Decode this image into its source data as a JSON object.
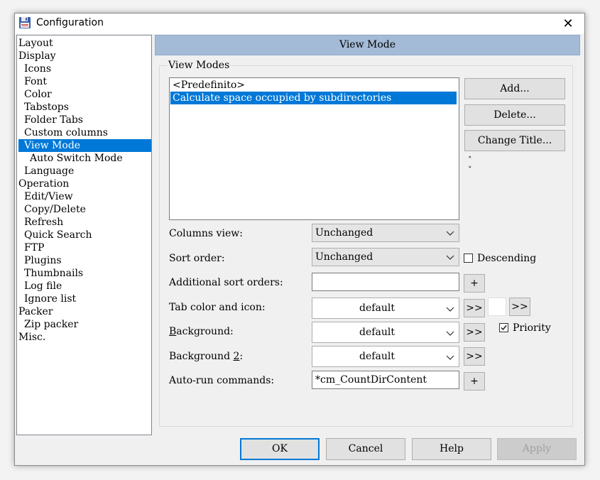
{
  "window": {
    "title": "Configuration",
    "close_glyph": "✕"
  },
  "tree": {
    "items": [
      {
        "label": "Layout"
      },
      {
        "label": "Display"
      },
      {
        "label": "Icons"
      },
      {
        "label": "Font"
      },
      {
        "label": "Color"
      },
      {
        "label": "Tabstops"
      },
      {
        "label": "Folder Tabs"
      },
      {
        "label": "Custom columns"
      },
      {
        "label": "View Mode",
        "selected": true
      },
      {
        "label": "Auto Switch Mode"
      },
      {
        "label": "Language"
      },
      {
        "label": "Operation"
      },
      {
        "label": "Edit/View"
      },
      {
        "label": "Copy/Delete"
      },
      {
        "label": "Refresh"
      },
      {
        "label": "Quick Search"
      },
      {
        "label": "FTP"
      },
      {
        "label": "Plugins"
      },
      {
        "label": "Thumbnails"
      },
      {
        "label": "Log file"
      },
      {
        "label": "Ignore list"
      },
      {
        "label": "Packer"
      },
      {
        "label": "Zip packer"
      },
      {
        "label": "Misc."
      }
    ]
  },
  "panel": {
    "header": "View Mode",
    "group_label": "View Modes",
    "view_modes": [
      {
        "label": "<Predefinito>"
      },
      {
        "label": "Calculate space occupied by subdirectories",
        "selected": true
      }
    ],
    "buttons": {
      "add": "Add...",
      "delete": "Delete...",
      "change_title": "Change Title..."
    },
    "scroll_up": "˄",
    "scroll_down": "˅",
    "fields": {
      "columns_view": {
        "label": "Columns view:",
        "value": "Unchanged"
      },
      "sort_order": {
        "label": "Sort order:",
        "value": "Unchanged"
      },
      "descending": {
        "label": "Descending",
        "checked": false
      },
      "additional_sort": {
        "label": "Additional sort orders:",
        "value": "",
        "plus": "+"
      },
      "tab_color": {
        "label": "Tab color and icon:",
        "value": "default",
        "more": ">>",
        "more2": ">>"
      },
      "background": {
        "label_pre": "",
        "label_u": "B",
        "label_post": "ackground:",
        "value": "default",
        "more": ">>"
      },
      "priority": {
        "label": "Priority",
        "checked": true
      },
      "background2": {
        "label_pre": "Background ",
        "label_u": "2",
        "label_post": ":",
        "value": "default",
        "more": ">>"
      },
      "autorun": {
        "label": "Auto-run commands:",
        "value": "*cm_CountDirContent",
        "plus": "+"
      }
    }
  },
  "footer": {
    "ok": "OK",
    "cancel": "Cancel",
    "help": "Help",
    "apply": "Apply"
  },
  "colors": {
    "header_bg": "#a3bbd6",
    "selection": "#0078d7"
  }
}
